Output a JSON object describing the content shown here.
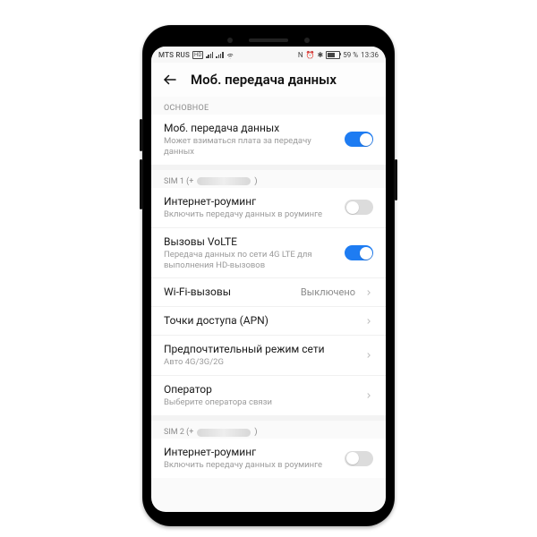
{
  "statusbar": {
    "carrier": "MTS RUS",
    "hd": "HD",
    "nfc": "N",
    "alarm": "⏰",
    "bt": "✱",
    "battery_text": "59 %",
    "time": "13:36"
  },
  "header": {
    "title": "Моб. передача данных"
  },
  "section_main": "ОСНОВНОЕ",
  "mobile_data": {
    "title": "Моб. передача данных",
    "sub": "Может взиматься плата за передачу данных",
    "on": true
  },
  "sim1_label_prefix": "SIM 1 (+",
  "sim1_label_suffix": ")",
  "roaming1": {
    "title": "Интернет-роуминг",
    "sub": "Включить передачу данных в роуминге",
    "on": false
  },
  "volte": {
    "title": "Вызовы VoLTE",
    "sub": "Передача данных по сети 4G LTE для выполнения HD-вызовов",
    "on": true
  },
  "wifi_call": {
    "title": "Wi-Fi-вызовы",
    "value": "Выключено"
  },
  "apn": {
    "title": "Точки доступа (APN)"
  },
  "net_mode": {
    "title": "Предпочтительный режим сети",
    "sub": "Авто 4G/3G/2G"
  },
  "operator": {
    "title": "Оператор",
    "sub": "Выберите оператора связи"
  },
  "sim2_label_prefix": "SIM 2 (+",
  "sim2_label_suffix": ")",
  "roaming2": {
    "title": "Интернет-роуминг",
    "sub": "Включить передачу данных в роуминге",
    "on": false
  },
  "colors": {
    "accent": "#1e7cf2"
  }
}
